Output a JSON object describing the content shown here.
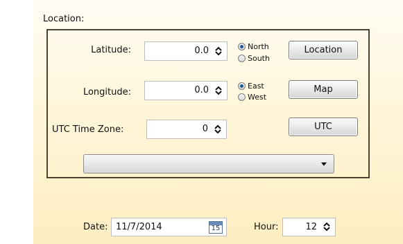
{
  "location": {
    "section_label": "Location:",
    "latitude": {
      "label": "Latitude:",
      "value": "0.0"
    },
    "longitude": {
      "label": "Longitude:",
      "value": "0.0"
    },
    "utc_zone": {
      "label": "UTC Time Zone:",
      "value": "0"
    },
    "lat_hemisphere": {
      "options": [
        "North",
        "South"
      ],
      "selected": "North"
    },
    "lon_hemisphere": {
      "options": [
        "East",
        "West"
      ],
      "selected": "East"
    },
    "buttons": {
      "location": "Location",
      "map": "Map",
      "utc": "UTC"
    },
    "dropdown": {
      "selected": ""
    }
  },
  "date": {
    "label": "Date:",
    "value": "11/7/2014",
    "calendar_day": "15"
  },
  "hour": {
    "label": "Hour:",
    "value": "12"
  },
  "icons": {
    "spinner": "up-down-spinner-icon",
    "dropdown": "chevron-down-icon",
    "calendar": "calendar-icon"
  },
  "colors": {
    "panel_top": "#fffdf4",
    "panel_bottom": "#fdeec2",
    "group_border": "#4a4330",
    "radio_selected": "#1e5a9a"
  }
}
